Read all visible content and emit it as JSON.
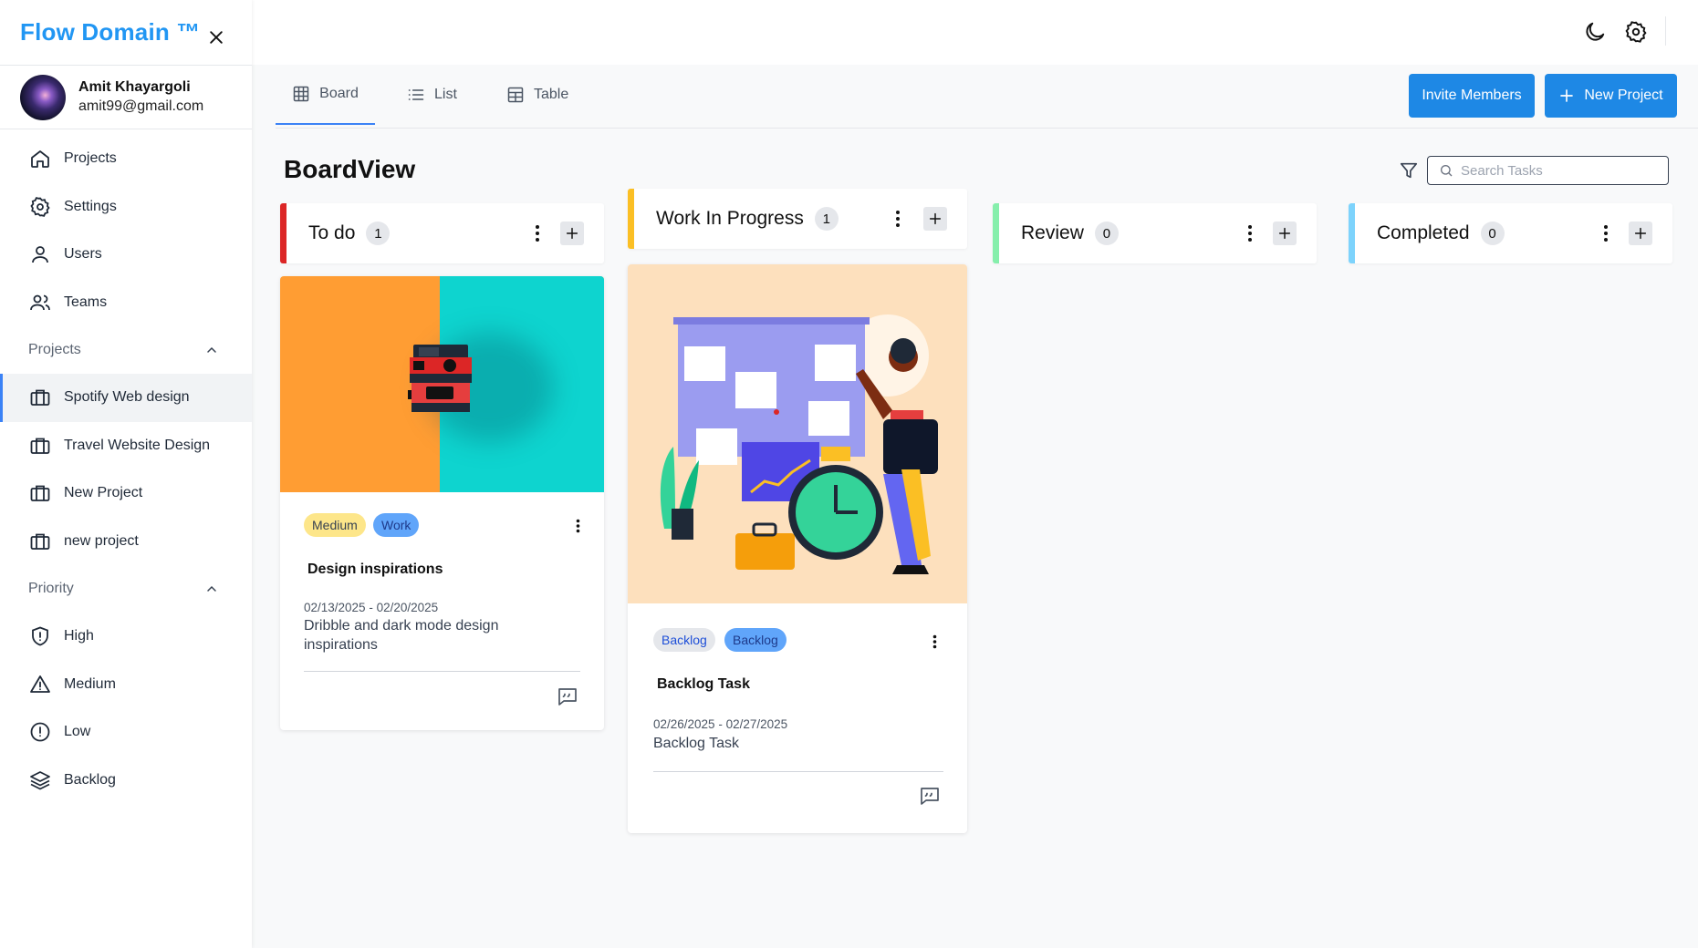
{
  "app": {
    "brand": "Flow Domain ™"
  },
  "user": {
    "name": "Amit Khayargoli",
    "email": "amit99@gmail.com"
  },
  "sidebar": {
    "main_items": [
      {
        "label": "Projects",
        "icon": "home-icon"
      },
      {
        "label": "Settings",
        "icon": "gear-icon"
      },
      {
        "label": "Users",
        "icon": "user-icon"
      },
      {
        "label": "Teams",
        "icon": "users-icon"
      }
    ],
    "projects_section": {
      "label": "Projects",
      "items": [
        {
          "label": "Spotify Web design",
          "icon": "briefcase-icon",
          "active": true
        },
        {
          "label": "Travel Website Design",
          "icon": "briefcase-icon"
        },
        {
          "label": "New Project",
          "icon": "briefcase-icon"
        },
        {
          "label": "new project",
          "icon": "briefcase-icon"
        }
      ]
    },
    "priority_section": {
      "label": "Priority",
      "items": [
        {
          "label": "High",
          "icon": "shield-alert-icon"
        },
        {
          "label": "Medium",
          "icon": "triangle-alert-icon"
        },
        {
          "label": "Low",
          "icon": "circle-alert-icon"
        },
        {
          "label": "Backlog",
          "icon": "layers-icon"
        }
      ]
    }
  },
  "tabs": [
    {
      "label": "Board",
      "icon": "grid-icon",
      "active": true
    },
    {
      "label": "List",
      "icon": "list-icon"
    },
    {
      "label": "Table",
      "icon": "table-icon"
    }
  ],
  "actions": {
    "invite": "Invite Members",
    "new_project": "New Project"
  },
  "board": {
    "title": "BoardView",
    "search_placeholder": "Search Tasks",
    "columns": [
      {
        "title": "To do",
        "count": "1",
        "color": "#dc2626"
      },
      {
        "title": "Work In Progress",
        "count": "1",
        "color": "#fbbf24"
      },
      {
        "title": "Review",
        "count": "0",
        "color": "#86efac"
      },
      {
        "title": "Completed",
        "count": "0",
        "color": "#7dd3fc"
      }
    ],
    "cards": [
      {
        "tags": [
          {
            "label": "Medium",
            "bg": "#fde68a",
            "fg": "#374151"
          },
          {
            "label": "Work",
            "bg": "#60a5fa",
            "fg": "#1e3a8a"
          }
        ],
        "title": "Design inspirations",
        "dates": "02/13/2025 - 02/20/2025",
        "description": "Dribble and dark mode design inspirations"
      },
      {
        "tags": [
          {
            "label": "Backlog",
            "bg": "#e5e7eb",
            "fg": "#1d4ed8"
          },
          {
            "label": "Backlog",
            "bg": "#60a5fa",
            "fg": "#1e3a8a"
          }
        ],
        "title": "Backlog Task",
        "dates": "02/26/2025 - 02/27/2025",
        "description": "Backlog Task"
      }
    ]
  },
  "colors": {
    "brand": "#2196f3",
    "primary_button": "#1e88e5",
    "active_tab_underline": "#3b82f6"
  }
}
